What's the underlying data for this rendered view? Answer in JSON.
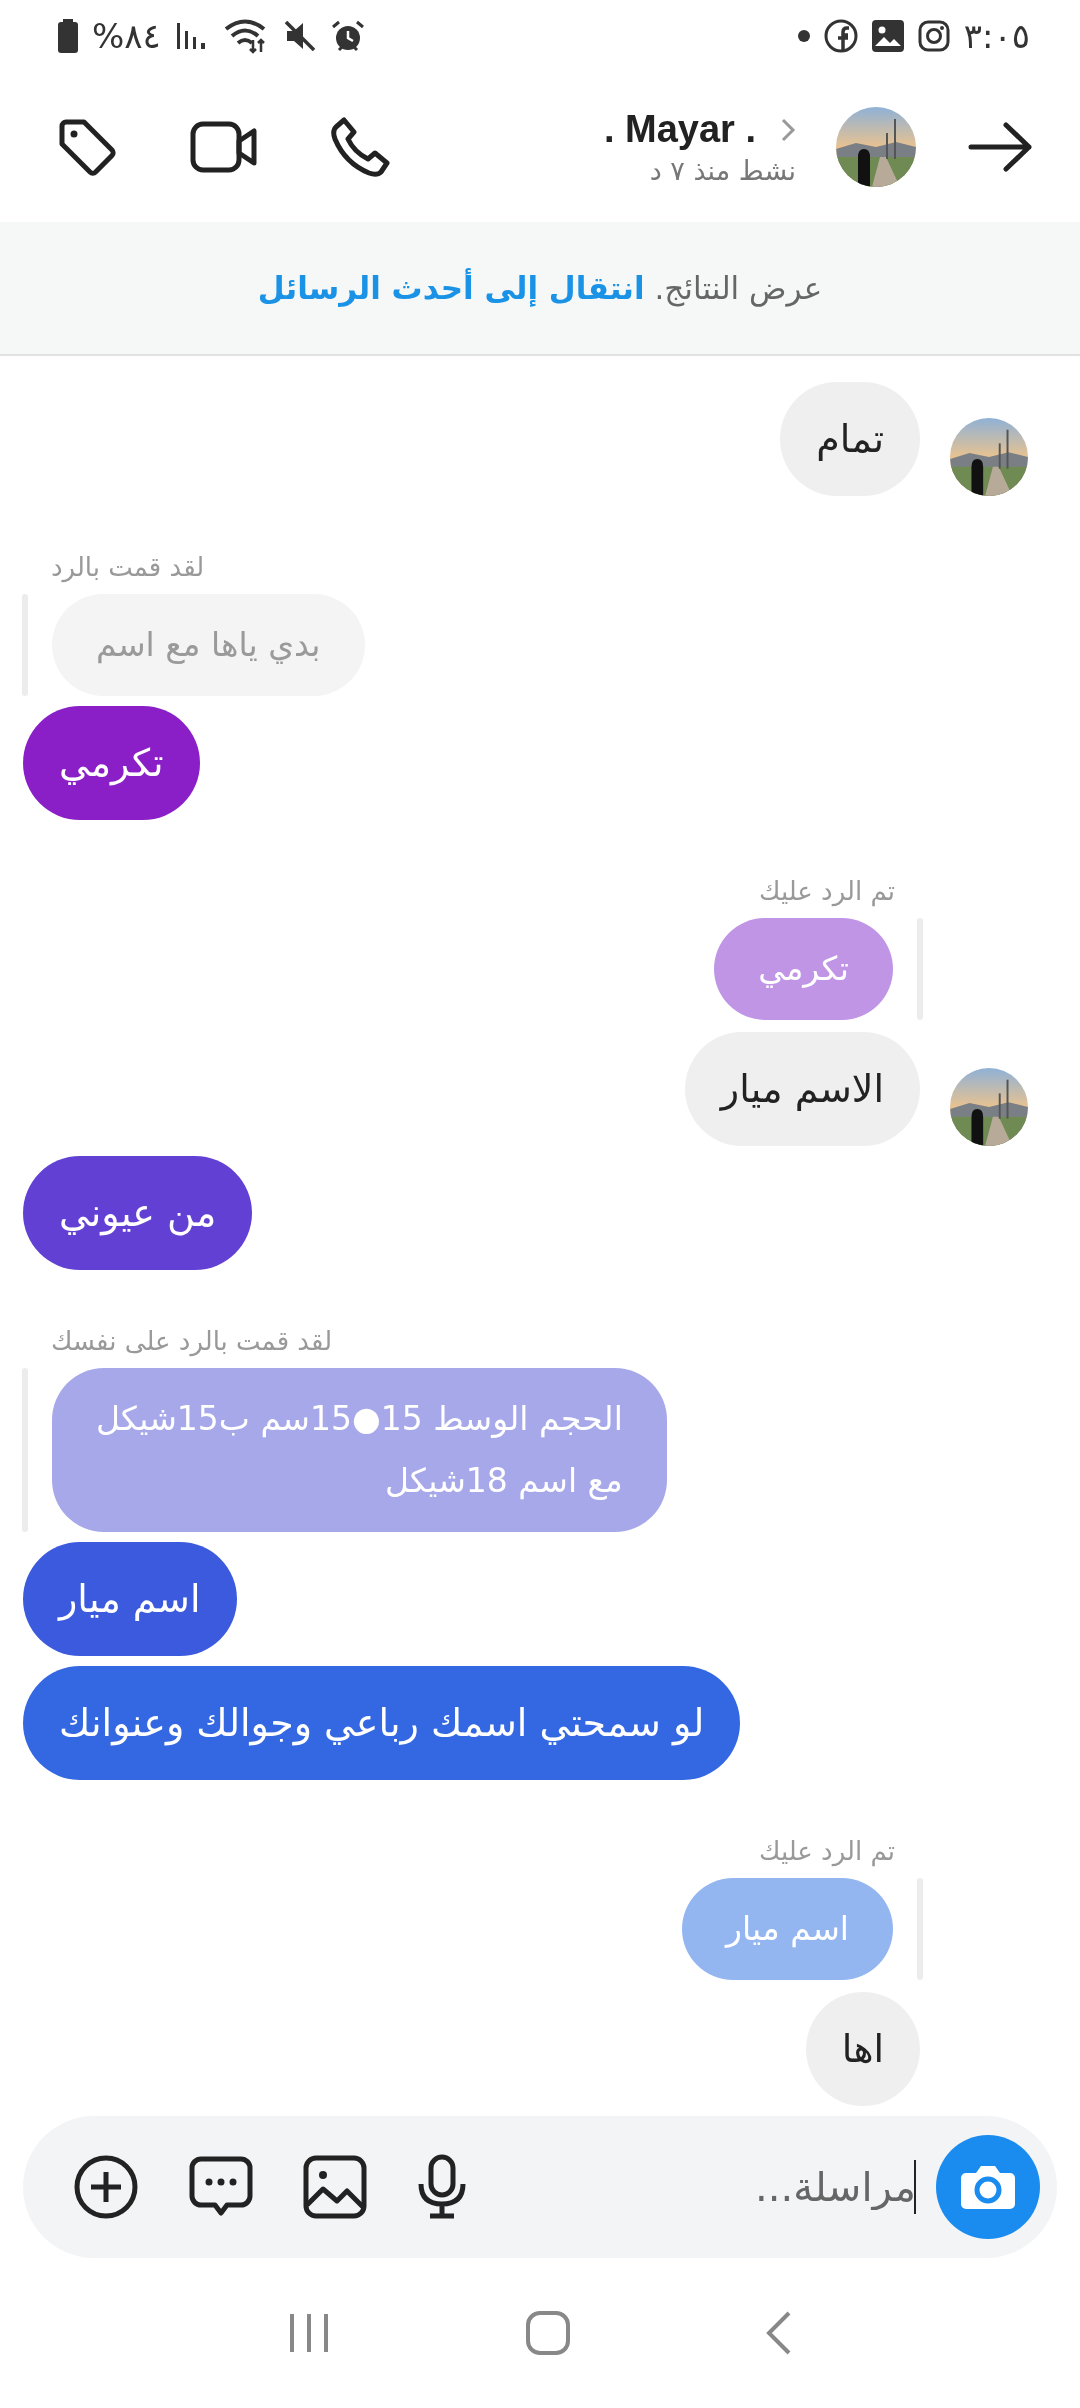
{
  "status_bar": {
    "battery_text": "%٨٤",
    "time": "٣:٠٥"
  },
  "header": {
    "name": ". Mayar .",
    "activity": "نشط منذ ٧ د"
  },
  "banner": {
    "text": "عرض النتائج.",
    "link": "انتقال إلى أحدث الرسائل"
  },
  "messages": [
    {
      "kind": "received",
      "text": "تمام",
      "avatar": true
    },
    {
      "kind": "note_sent",
      "text": "لقد قمت بالرد"
    },
    {
      "kind": "quote_sent",
      "text": "بدي ياها مع اسم",
      "color": "#f4f4f4"
    },
    {
      "kind": "sent",
      "text": "تكرمي",
      "color": "#8a1fc8"
    },
    {
      "kind": "note_received",
      "text": "تم الرد عليك"
    },
    {
      "kind": "quote_received",
      "text": "تكرمي",
      "color": "#c095e6"
    },
    {
      "kind": "received",
      "text": "الاسم ميار",
      "avatar": true
    },
    {
      "kind": "sent",
      "text": "من عيوني",
      "color": "#6240d4"
    },
    {
      "kind": "note_sent",
      "text": "لقد قمت بالرد على نفسك"
    },
    {
      "kind": "quote_sent",
      "text": "الحجم الوسط 15●15سم ب15شيكل\nمع اسم  18شيكل",
      "color": "#a6a8ea"
    },
    {
      "kind": "sent",
      "text": "اسم ميار",
      "color": "#3c5ade"
    },
    {
      "kind": "sent",
      "text": "لو سمحتي اسمك رباعي وجوالك وعنوانك",
      "color": "#3468e2"
    },
    {
      "kind": "note_received",
      "text": "تم الرد عليك"
    },
    {
      "kind": "quote_received",
      "text": "اسم ميار",
      "color": "#93b6f0"
    },
    {
      "kind": "received",
      "text": "اها",
      "avatar": false
    }
  ],
  "composer": {
    "placeholder": "مراسلة..."
  }
}
